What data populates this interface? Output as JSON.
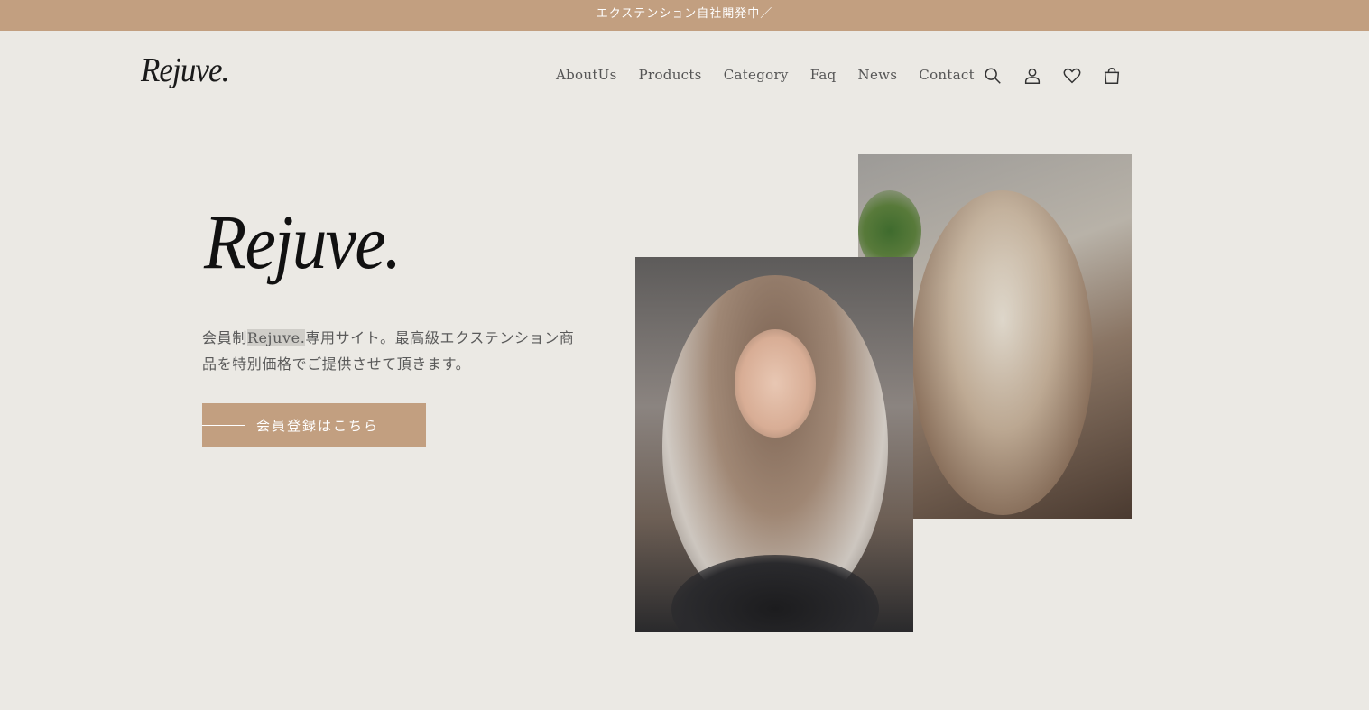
{
  "announcement": {
    "text": "エクステンション自社開発中／"
  },
  "header": {
    "logo": "Rejuve.",
    "nav": [
      "AboutUs",
      "Products",
      "Category",
      "Faq",
      "News",
      "Contact"
    ],
    "icons": [
      "search-icon",
      "account-icon",
      "heart-icon",
      "cart-icon"
    ]
  },
  "hero": {
    "title": "Rejuve.",
    "desc_prefix": "会員制",
    "desc_highlight": "Rejuve.",
    "desc_suffix": "専用サイト。最高級エクステンション商品を特別価格でご提供させて頂きます。",
    "cta_label": "会員登録はこちら"
  },
  "colors": {
    "accent": "#c29f80",
    "background": "#ebe9e4"
  }
}
